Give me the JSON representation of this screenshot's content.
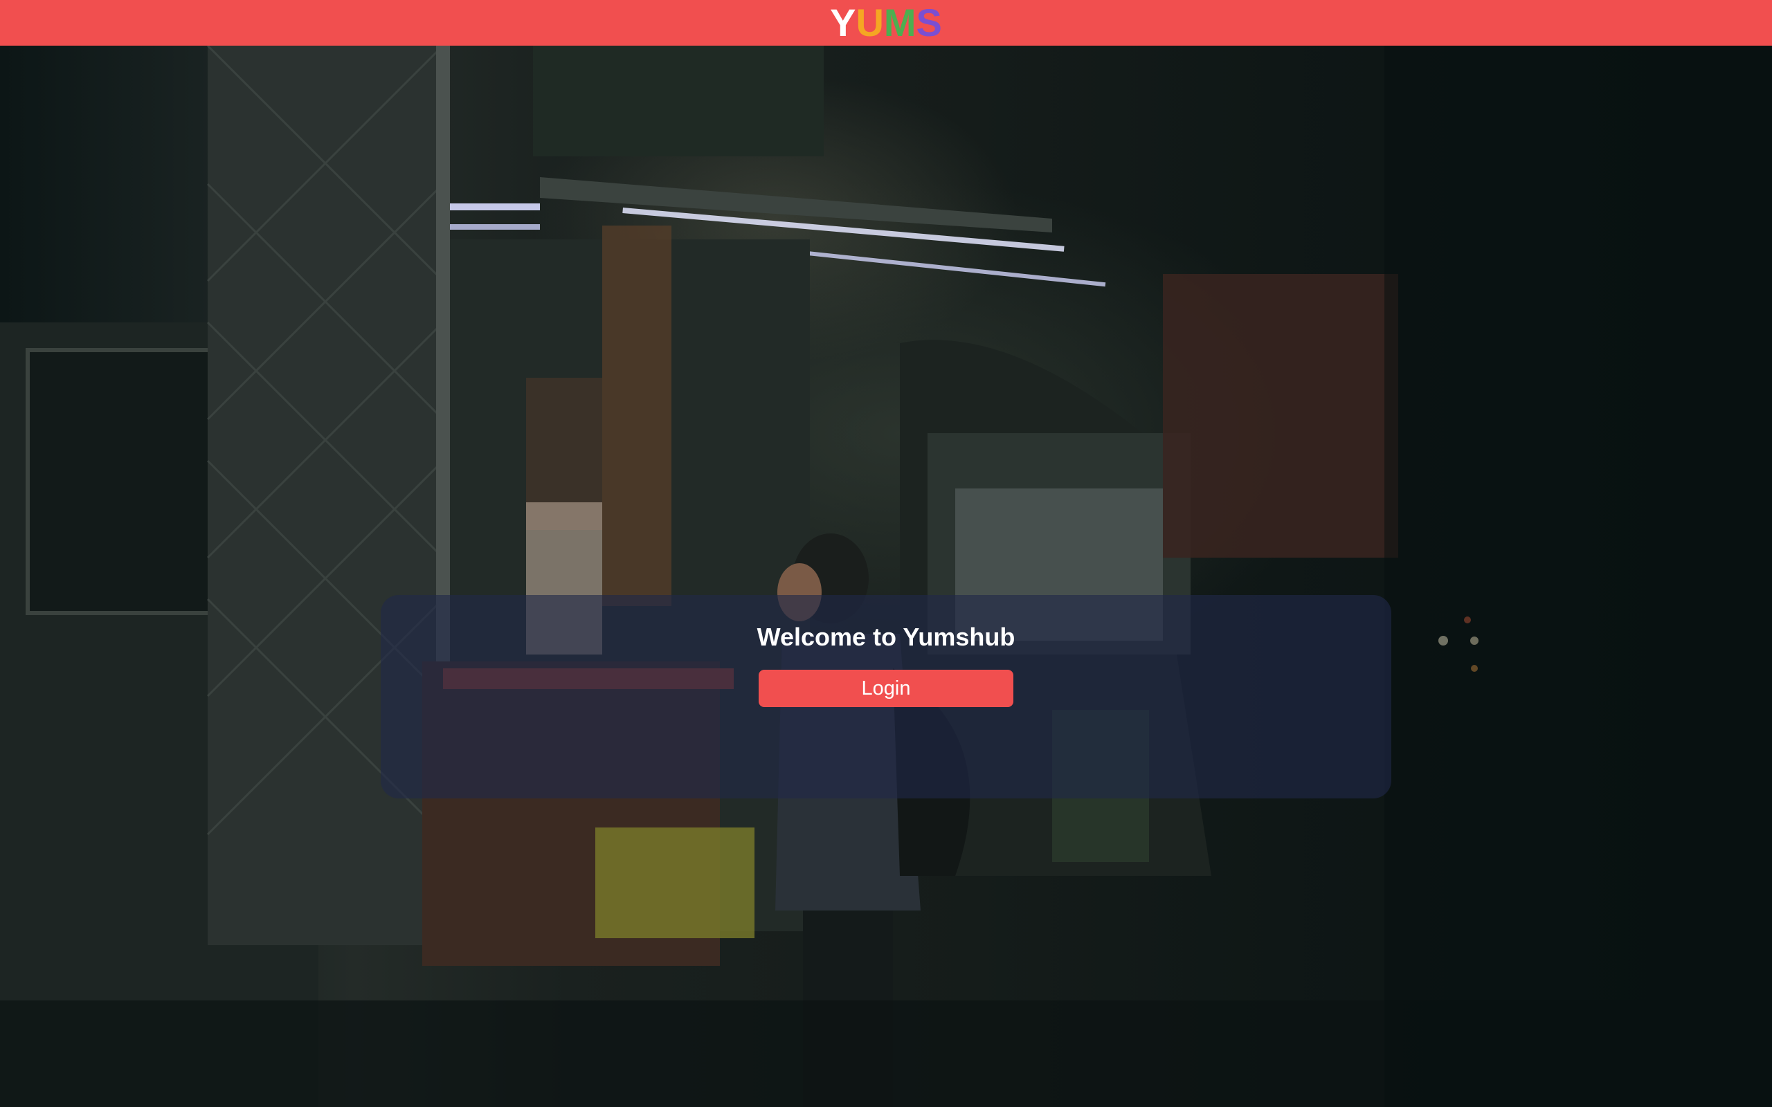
{
  "header": {
    "logo_letters": [
      {
        "char": "Y",
        "color": "#ffffff"
      },
      {
        "char": "U",
        "color": "#f5a623"
      },
      {
        "char": "M",
        "color": "#4caf50"
      },
      {
        "char": "S",
        "color": "#7b4fd1"
      }
    ],
    "background_color": "#f14f4f"
  },
  "hero": {
    "image_description_icon": "food-truck-night-photo"
  },
  "welcome": {
    "title": "Welcome to Yumshub",
    "login_label": "Login"
  },
  "colors": {
    "accent": "#f14f4f",
    "card": "#202848"
  }
}
